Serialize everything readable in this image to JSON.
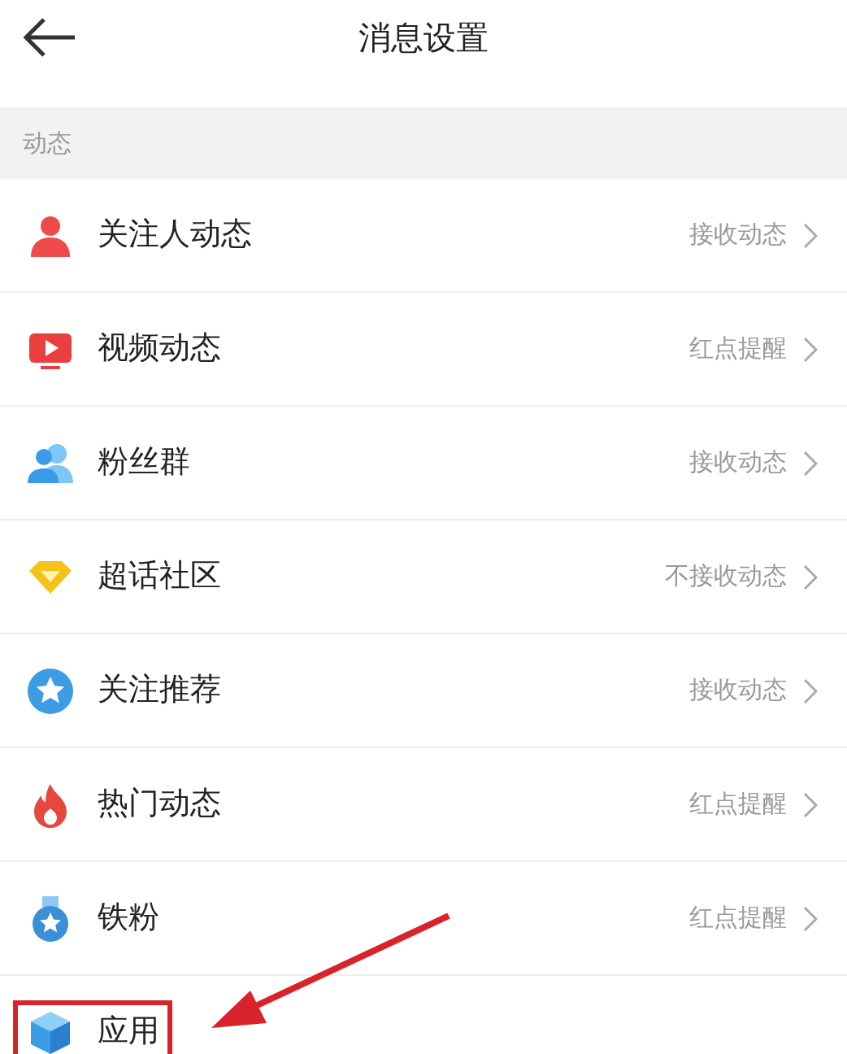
{
  "header": {
    "title": "消息设置"
  },
  "section": {
    "label": "动态"
  },
  "rows": [
    {
      "label": "关注人动态",
      "value": "接收动态"
    },
    {
      "label": "视频动态",
      "value": "红点提醒"
    },
    {
      "label": "粉丝群",
      "value": "接收动态"
    },
    {
      "label": "超话社区",
      "value": "不接收动态"
    },
    {
      "label": "关注推荐",
      "value": "接收动态"
    },
    {
      "label": "热门动态",
      "value": "红点提醒"
    },
    {
      "label": "铁粉",
      "value": "红点提醒"
    },
    {
      "label": "应用",
      "highlighted": true
    }
  ]
}
